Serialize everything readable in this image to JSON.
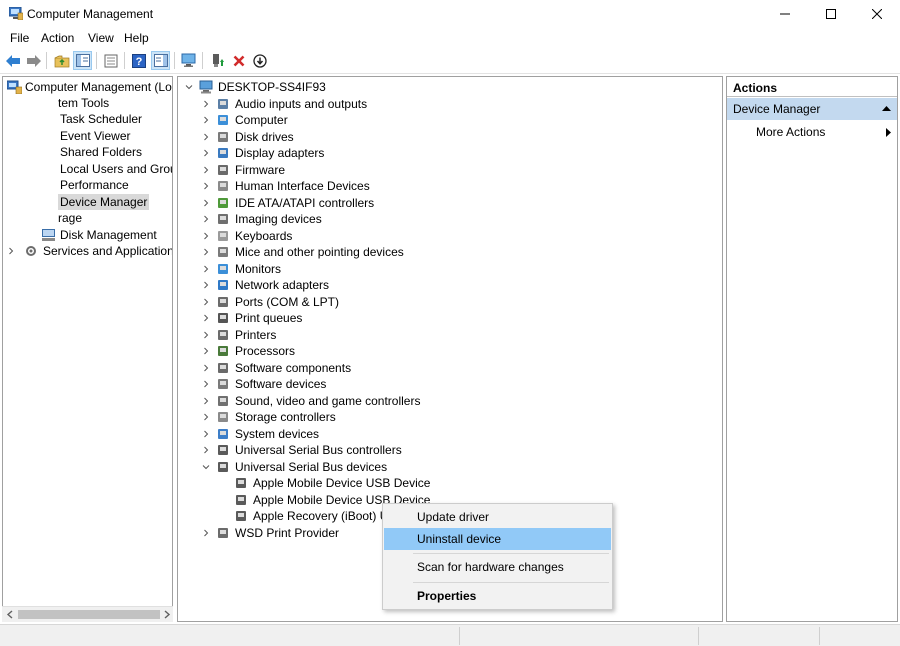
{
  "window": {
    "title": "Computer Management",
    "controls": [
      "minimize",
      "maximize",
      "close"
    ]
  },
  "menubar": [
    "File",
    "Action",
    "View",
    "Help"
  ],
  "toolbar": {
    "buttons": [
      "back",
      "forward",
      "up-folder",
      "show-hide-tree",
      "properties",
      "help",
      "show-action-pane",
      "scan-hardware",
      "uninstall",
      "update-driver"
    ]
  },
  "left_tree": [
    {
      "label": "Computer Management (Local",
      "icon": "computer-management-icon",
      "expander": "open"
    },
    {
      "label": "tem Tools"
    },
    {
      "label": "Task Scheduler"
    },
    {
      "label": "Event Viewer"
    },
    {
      "label": "Shared Folders"
    },
    {
      "label": "Local Users and Groups"
    },
    {
      "label": "Performance"
    },
    {
      "label": "Device Manager",
      "selected": true
    },
    {
      "label": "rage"
    },
    {
      "label": "Disk Management",
      "icon": "disk-management-icon"
    },
    {
      "label": "Services and Applications",
      "expander": "closed"
    }
  ],
  "device_tree": {
    "root": "DESKTOP-SS4IF93",
    "categories": [
      "Audio inputs and outputs",
      "Computer",
      "Disk drives",
      "Display adapters",
      "Firmware",
      "Human Interface Devices",
      "IDE ATA/ATAPI controllers",
      "Imaging devices",
      "Keyboards",
      "Mice and other pointing devices",
      "Monitors",
      "Network adapters",
      "Ports (COM & LPT)",
      "Print queues",
      "Printers",
      "Processors",
      "Software components",
      "Software devices",
      "Sound, video and game controllers",
      "Storage controllers",
      "System devices",
      "Universal Serial Bus controllers",
      "Universal Serial Bus devices"
    ],
    "usb_devices": [
      "Apple Mobile Device USB Device",
      "Apple Mobile Device USB Device",
      "Apple Recovery (iBoot) USB"
    ],
    "last_category": "WSD Print Provider"
  },
  "actions_pane": {
    "header": "Actions",
    "section": "Device Manager",
    "more": "More Actions"
  },
  "context_menu": {
    "items": [
      "Update driver",
      "Uninstall device",
      "Scan for hardware changes",
      "Properties"
    ],
    "highlighted": "Uninstall device"
  }
}
